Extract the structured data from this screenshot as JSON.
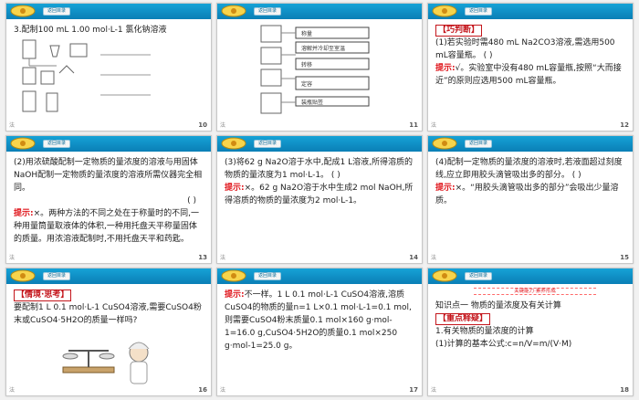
{
  "header": {
    "back_label": "返回目录"
  },
  "slides": [
    {
      "page": "10",
      "corner": "法",
      "title": "3.配制100 mL 1.00 mol·L-1 氯化钠溶液",
      "diagram_labels": [
        "①计算",
        "②称量",
        "③溶解",
        "④转移",
        "⑤洗涤",
        "⑥定容",
        "⑦摇匀"
      ]
    },
    {
      "page": "11",
      "corner": "法",
      "steps": [
        "称量",
        "溶解并冷却至室温",
        "转移",
        "洗涤烧杯内壁和玻璃棒",
        "定容",
        "摇匀",
        "装瓶贴签"
      ]
    },
    {
      "page": "12",
      "corner": "法",
      "tag": "【巧判断】",
      "q": "(1)若实验时需480 mL Na2CO3溶液,需选用500 mL容量瓶。 (    )",
      "hint_label": "提示:",
      "hint": "√。实验室中没有480 mL容量瓶,按照“大而接近”的原则应选用500 mL容量瓶。"
    },
    {
      "page": "13",
      "corner": "法",
      "q": "(2)用浓硫酸配制一定物质的量浓度的溶液与用固体NaOH配制一定物质的量浓度的溶液所需仪器完全相同。",
      "paren": "(    )",
      "hint_label": "提示:",
      "hint": "×。两种方法的不同之处在于称量时的不同,一种用量筒量取液体的体积,一种用托盘天平称量固体的质量。用浓溶液配制时,不用托盘天平和药匙。"
    },
    {
      "page": "14",
      "corner": "法",
      "q": "(3)将62 g Na2O溶于水中,配成1 L溶液,所得溶质的物质的量浓度为1 mol·L-1。 (    )",
      "hint_label": "提示:",
      "hint": "×。62 g Na2O溶于水中生成2 mol NaOH,所得溶质的物质的量浓度为2 mol·L-1。"
    },
    {
      "page": "15",
      "corner": "法",
      "q": "(4)配制一定物质的量浓度的溶液时,若液面超过刻度线,应立即用胶头滴管吸出多的部分。 (    )",
      "hint_label": "提示:",
      "hint": "×。“用胶头滴管吸出多的部分”会吸出少量溶质。"
    },
    {
      "page": "16",
      "corner": "法",
      "tag": "【情境·思考】",
      "q": "要配制1 L 0.1 mol·L-1 CuSO4溶液,需要CuSO4粉末或CuSO4·5H2O的质量一样吗?"
    },
    {
      "page": "17",
      "corner": "法",
      "hint_label": "提示:",
      "hint": "不一样。1 L 0.1 mol·L-1 CuSO4溶液,溶质CuSO4的物质的量n=1 L×0.1 mol·L-1=0.1 mol,则需要CuSO4粉末质量0.1 mol×160 g·mol-1=16.0 g,CuSO4·5H2O的质量0.1 mol×250 g·mol-1=25.0 g。"
    },
    {
      "page": "18",
      "corner": "法",
      "band": "关键能力·素养形成",
      "kp": "知识点一  物质的量浓度及有关计算",
      "tag": "【重点释疑】",
      "l1": "1.有关物质的量浓度的计算",
      "l2": "(1)计算的基本公式:c=n/V=m/(V·M)"
    }
  ]
}
